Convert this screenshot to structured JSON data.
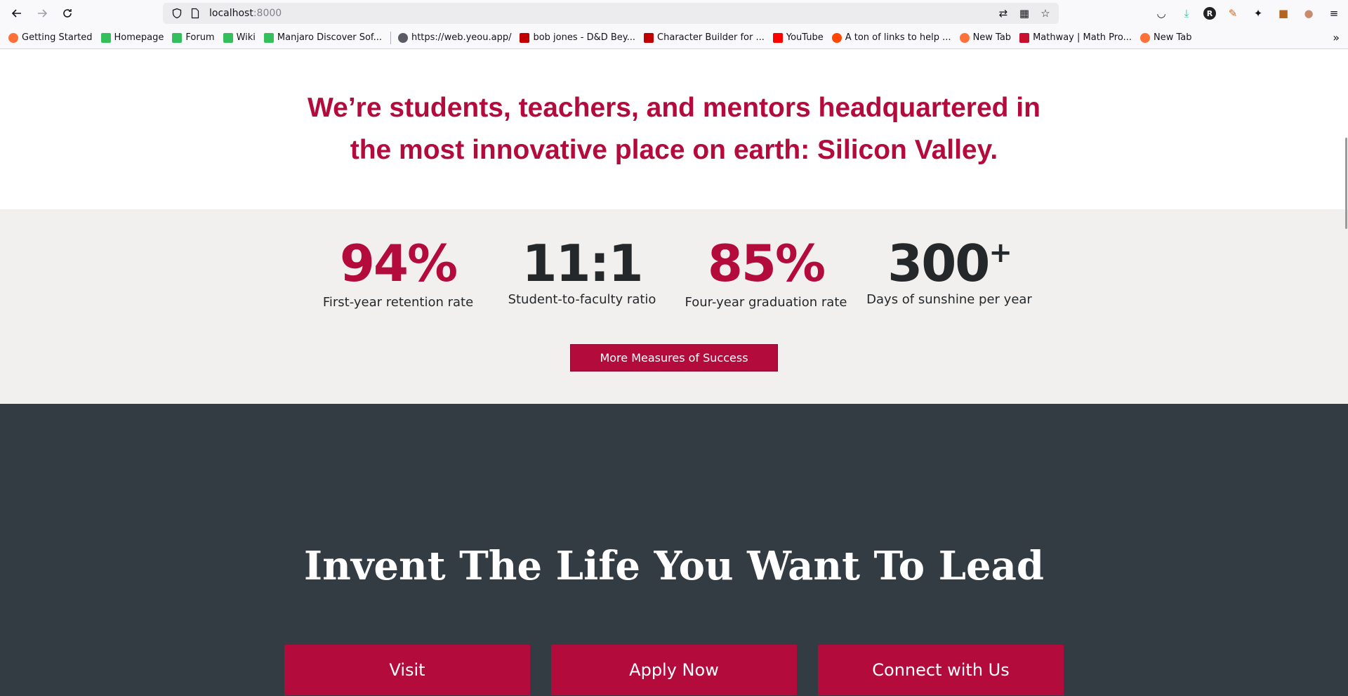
{
  "browser": {
    "url_host": "localhost",
    "url_port": ":8000",
    "bookmarks": [
      {
        "label": "Getting Started",
        "icon": "firefox-icon",
        "color": "#ff7139"
      },
      {
        "label": "Homepage",
        "icon": "manjaro-icon",
        "color": "#35bf5c"
      },
      {
        "label": "Forum",
        "icon": "manjaro-icon",
        "color": "#35bf5c"
      },
      {
        "label": "Wiki",
        "icon": "manjaro-icon",
        "color": "#35bf5c"
      },
      {
        "label": "Manjaro Discover Sof...",
        "icon": "manjaro-icon",
        "color": "#35bf5c"
      },
      {
        "label": "https://web.yeou.app/",
        "icon": "globe-icon",
        "color": "#5b5b66"
      },
      {
        "label": "bob jones - D&D Bey...",
        "icon": "dndbeyond-icon",
        "color": "#c00000"
      },
      {
        "label": "Character Builder for ...",
        "icon": "dndbeyond-icon",
        "color": "#c00000"
      },
      {
        "label": "YouTube",
        "icon": "youtube-icon",
        "color": "#ff0000"
      },
      {
        "label": "A ton of links to help ...",
        "icon": "reddit-icon",
        "color": "#ff4500"
      },
      {
        "label": "New Tab",
        "icon": "firefox-icon",
        "color": "#ff7139"
      },
      {
        "label": "Mathway | Math Pro...",
        "icon": "mathway-icon",
        "color": "#c8102e"
      },
      {
        "label": "New Tab",
        "icon": "firefox-icon",
        "color": "#ff7139"
      }
    ]
  },
  "page": {
    "headline": "We’re students, teachers, and mentors headquartered in the most innovative place on earth: Silicon Valley.",
    "stats": [
      {
        "value": "94%",
        "label": "First-year retention rate",
        "color": "red"
      },
      {
        "value": "11:1",
        "label": "Student-to-faculty ratio",
        "color": "dark"
      },
      {
        "value": "85%",
        "label": "Four-year graduation rate",
        "color": "red"
      },
      {
        "value": "300",
        "suffix": "+",
        "label": "Days of sunshine per year",
        "color": "dark"
      }
    ],
    "more_button": "More Measures of Success",
    "cta_title": "Invent The Life You Want To Lead",
    "cta_buttons": [
      "Visit",
      "Apply Now",
      "Connect with Us"
    ]
  },
  "colors": {
    "brand_red": "#b40b3d",
    "dark_bg": "#343c43",
    "stats_bg": "#f2f0ef"
  }
}
